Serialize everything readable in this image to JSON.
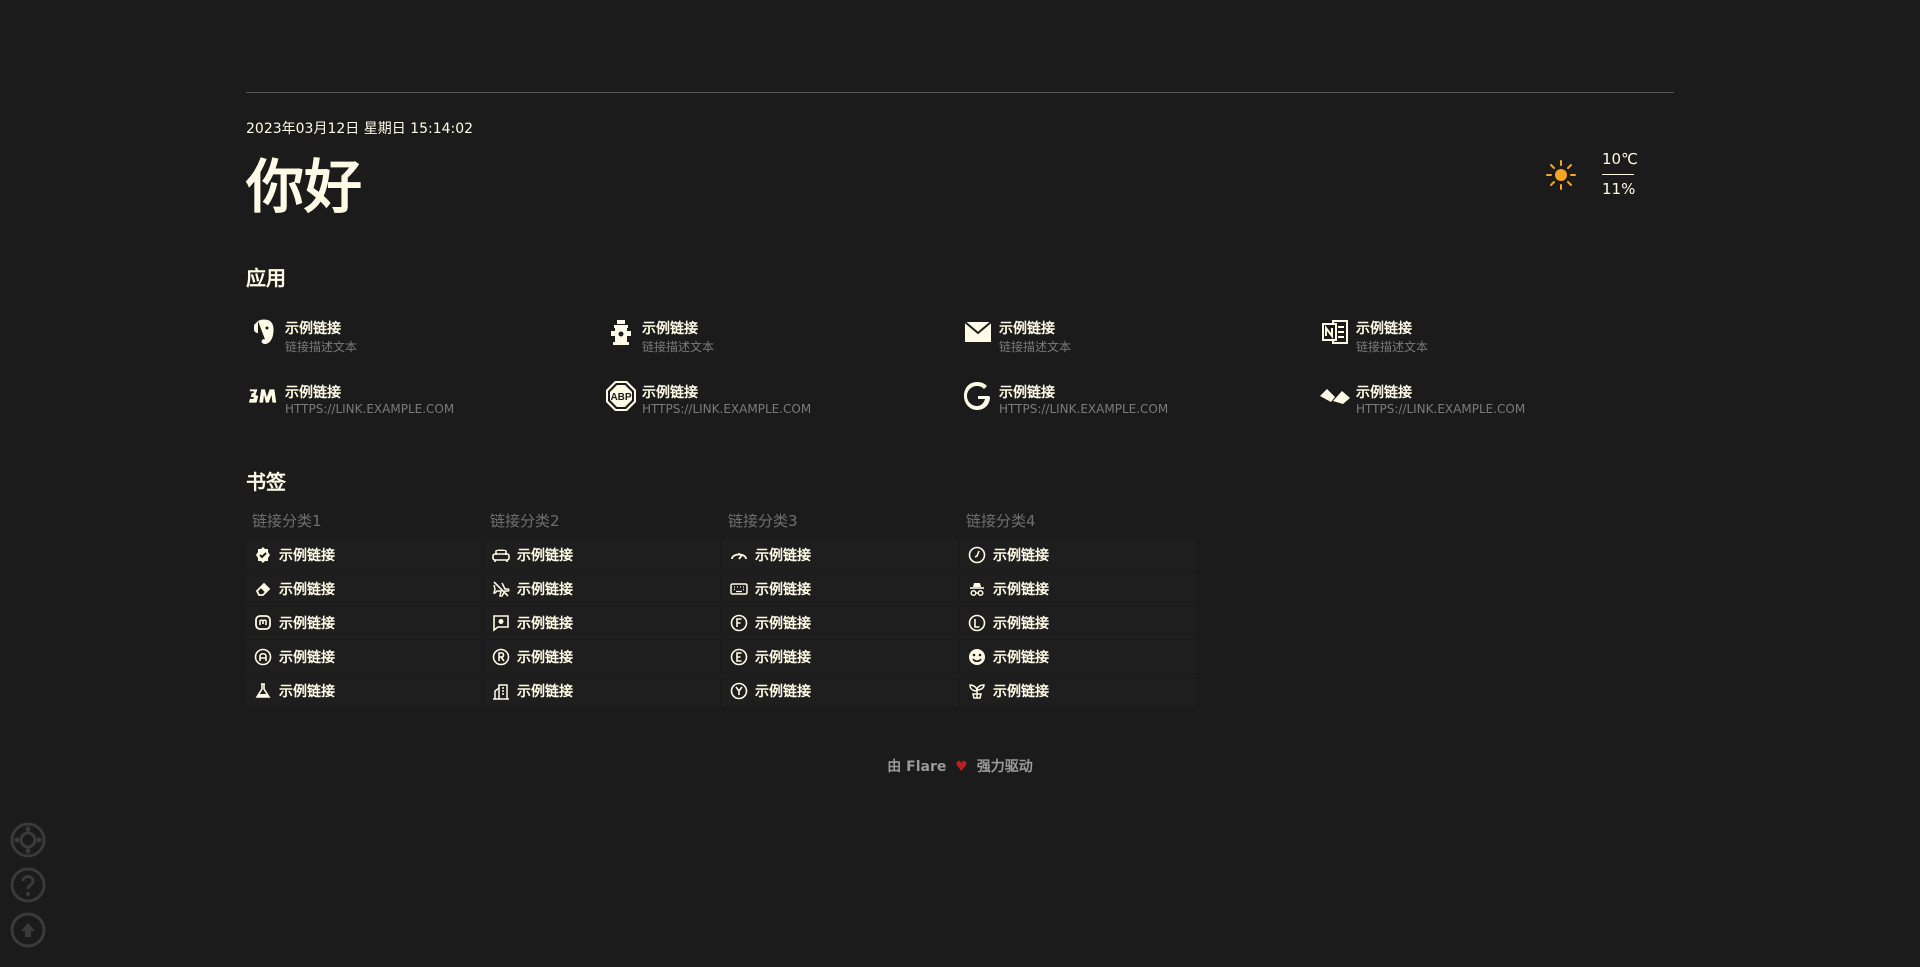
{
  "header": {
    "datetime": "2023年03月12日 星期日 15:14:02",
    "greeting": "你好"
  },
  "weather": {
    "icon": "sun-icon",
    "temperature": "10℃",
    "humidity": "11%",
    "icon_color": "#f5a623"
  },
  "apps": {
    "title": "应用",
    "items": [
      {
        "icon": "evernote-icon",
        "name": "示例链接",
        "desc": "链接描述文本"
      },
      {
        "icon": "fire-hydrant-icon",
        "name": "示例链接",
        "desc": "链接描述文本"
      },
      {
        "icon": "mail-icon",
        "name": "示例链接",
        "desc": "链接描述文本"
      },
      {
        "icon": "onenote-icon",
        "name": "示例链接",
        "desc": "链接描述文本"
      },
      {
        "icon": "3m-icon",
        "name": "示例链接",
        "desc": "HTTPS://LINK.EXAMPLE.COM"
      },
      {
        "icon": "adblock-icon",
        "name": "示例链接",
        "desc": "HTTPS://LINK.EXAMPLE.COM"
      },
      {
        "icon": "google-icon",
        "name": "示例链接",
        "desc": "HTTPS://LINK.EXAMPLE.COM"
      },
      {
        "icon": "abstract-icon",
        "name": "示例链接",
        "desc": "HTTPS://LINK.EXAMPLE.COM"
      }
    ]
  },
  "bookmarks": {
    "title": "书签",
    "categories": [
      {
        "name": "链接分类1",
        "links": [
          {
            "icon": "verified-badge-icon",
            "name": "示例链接"
          },
          {
            "icon": "eraser-icon",
            "name": "示例链接"
          },
          {
            "icon": "mastodon-icon",
            "name": "示例链接"
          },
          {
            "icon": "circle-a-icon",
            "name": "示例链接"
          },
          {
            "icon": "flask-icon",
            "name": "示例链接"
          }
        ]
      },
      {
        "name": "链接分类2",
        "links": [
          {
            "icon": "sofa-icon",
            "name": "示例链接"
          },
          {
            "icon": "plane-off-icon",
            "name": "示例链接"
          },
          {
            "icon": "message-report-icon",
            "name": "示例链接"
          },
          {
            "icon": "circle-r-icon",
            "name": "示例链接"
          },
          {
            "icon": "building-community-icon",
            "name": "示例链接"
          }
        ]
      },
      {
        "name": "链接分类3",
        "links": [
          {
            "icon": "gauge-icon",
            "name": "示例链接"
          },
          {
            "icon": "keyboard-icon",
            "name": "示例链接"
          },
          {
            "icon": "circle-f-icon",
            "name": "示例链接"
          },
          {
            "icon": "circle-e-icon",
            "name": "示例链接"
          },
          {
            "icon": "circle-y-icon",
            "name": "示例链接"
          }
        ]
      },
      {
        "name": "链接分类4",
        "links": [
          {
            "icon": "clock-icon",
            "name": "示例链接"
          },
          {
            "icon": "incognito-icon",
            "name": "示例链接"
          },
          {
            "icon": "circle-l-icon",
            "name": "示例链接"
          },
          {
            "icon": "mood-icon",
            "name": "示例链接"
          },
          {
            "icon": "plant-icon",
            "name": "示例链接"
          }
        ]
      }
    ]
  },
  "footer": {
    "prefix": "由 Flare",
    "heart": "♥",
    "suffix": "强力驱动"
  },
  "side_buttons": [
    {
      "icon": "settings-icon"
    },
    {
      "icon": "help-icon"
    },
    {
      "icon": "arrow-up-icon"
    }
  ]
}
